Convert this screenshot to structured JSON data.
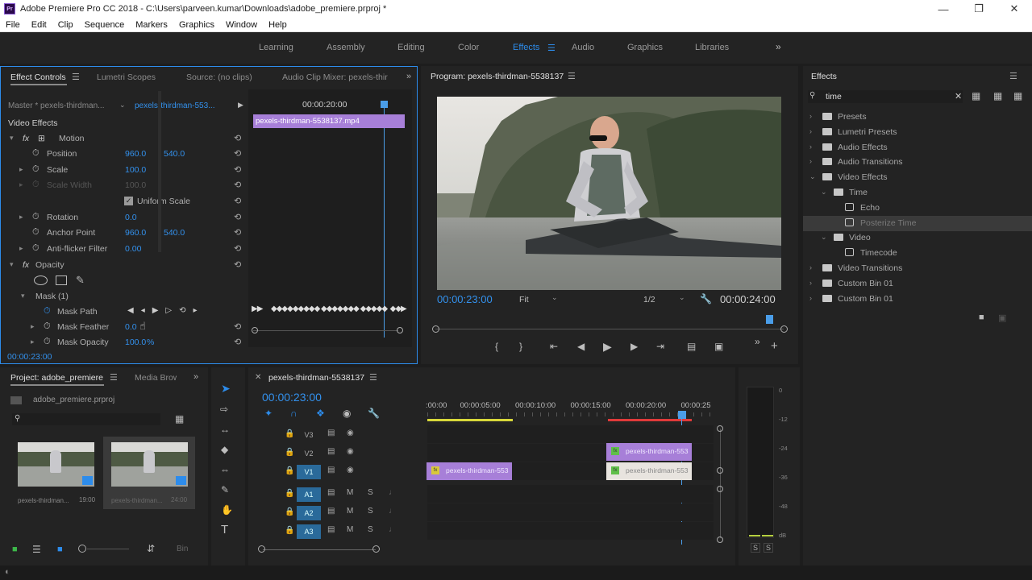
{
  "app": {
    "icon_text": "Pr",
    "title": "Adobe Premiere Pro CC 2018 - C:\\Users\\parveen.kumar\\Downloads\\adobe_premiere.prproj *"
  },
  "menus": [
    "File",
    "Edit",
    "Clip",
    "Sequence",
    "Markers",
    "Graphics",
    "Window",
    "Help"
  ],
  "workspaces": [
    "Learning",
    "Assembly",
    "Editing",
    "Color",
    "Effects",
    "Audio",
    "Graphics",
    "Libraries"
  ],
  "active_workspace": "Effects",
  "effect_controls": {
    "tabs": [
      "Effect Controls",
      "Lumetri Scopes",
      "Source: (no clips)",
      "Audio Clip Mixer: pexels-thir"
    ],
    "master_label": "Master * pexels-thirdman...",
    "sequence_label": "pexels-thirdman-553...",
    "timecode_ruler": "00:00:20:00",
    "clip_name": "pexels-thirdman-5538137.mp4",
    "section": "Video Effects",
    "rows": {
      "motion": "Motion",
      "position": {
        "label": "Position",
        "v1": "960.0",
        "v2": "540.0"
      },
      "scale": {
        "label": "Scale",
        "v1": "100.0"
      },
      "scale_width": {
        "label": "Scale Width",
        "v1": "100.0"
      },
      "uniform_scale": "Uniform Scale",
      "rotation": {
        "label": "Rotation",
        "v1": "0.0"
      },
      "anchor": {
        "label": "Anchor Point",
        "v1": "960.0",
        "v2": "540.0"
      },
      "anti_flicker": {
        "label": "Anti-flicker Filter",
        "v1": "0.00"
      },
      "opacity": "Opacity",
      "mask": "Mask (1)",
      "mask_path": "Mask Path",
      "mask_feather": {
        "label": "Mask Feather",
        "v1": "0.0"
      },
      "mask_opacity": {
        "label": "Mask Opacity",
        "v1": "100.0",
        "unit": "%"
      }
    },
    "current_time": "00:00:23:00"
  },
  "program": {
    "title": "Program: pexels-thirdman-5538137",
    "current_time": "00:00:23:00",
    "fit": "Fit",
    "resolution": "1/2",
    "duration": "00:00:24:00"
  },
  "effects_panel": {
    "title": "Effects",
    "search_value": "time",
    "tree": [
      {
        "label": "Presets",
        "indent": 0,
        "kind": "folder",
        "arrow": "closed"
      },
      {
        "label": "Lumetri Presets",
        "indent": 0,
        "kind": "folder",
        "arrow": "closed"
      },
      {
        "label": "Audio Effects",
        "indent": 0,
        "kind": "folder",
        "arrow": "closed"
      },
      {
        "label": "Audio Transitions",
        "indent": 0,
        "kind": "folder",
        "arrow": "closed"
      },
      {
        "label": "Video Effects",
        "indent": 0,
        "kind": "folder",
        "arrow": "open"
      },
      {
        "label": "Time",
        "indent": 1,
        "kind": "folder",
        "arrow": "open"
      },
      {
        "label": "Echo",
        "indent": 2,
        "kind": "effect",
        "arrow": "none"
      },
      {
        "label": "Posterize Time",
        "indent": 2,
        "kind": "effect",
        "arrow": "none",
        "selected": true
      },
      {
        "label": "Video",
        "indent": 1,
        "kind": "folder",
        "arrow": "open"
      },
      {
        "label": "Timecode",
        "indent": 2,
        "kind": "effect",
        "arrow": "none"
      },
      {
        "label": "Video Transitions",
        "indent": 0,
        "kind": "folder",
        "arrow": "closed"
      },
      {
        "label": "Custom Bin 01",
        "indent": 0,
        "kind": "folder",
        "arrow": "closed"
      },
      {
        "label": "Custom Bin 01",
        "indent": 0,
        "kind": "folder",
        "arrow": "closed"
      }
    ]
  },
  "project": {
    "tabs": [
      "Project: adobe_premiere",
      "Media Brow"
    ],
    "file": "adobe_premiere.prproj",
    "items": [
      {
        "name": "pexels-thirdman...",
        "duration": "19:00"
      },
      {
        "name": "pexels-thirdman...",
        "duration": "24:00"
      }
    ],
    "bin_label": "Bin"
  },
  "timeline": {
    "tab": "pexels-thirdman-5538137",
    "timecode": "00:00:23:00",
    "ruler": [
      ":00:00",
      "00:00:05:00",
      "00:00:10:00",
      "00:00:15:00",
      "00:00:20:00",
      "00:00:25"
    ],
    "tracks": [
      {
        "name": "V3",
        "on": false,
        "kind": "video"
      },
      {
        "name": "V2",
        "on": false,
        "kind": "video"
      },
      {
        "name": "V1",
        "on": true,
        "kind": "video"
      },
      {
        "name": "A1",
        "on": true,
        "kind": "audio"
      },
      {
        "name": "A2",
        "on": true,
        "kind": "audio"
      },
      {
        "name": "A3",
        "on": true,
        "kind": "audio"
      }
    ],
    "clips": [
      {
        "label": "pexels-thirdman-553",
        "badge": "fx"
      },
      {
        "label": "pexels-thirdman-553",
        "badge": "fx"
      },
      {
        "label": "pexels-thirdman-553",
        "badge": "fx"
      }
    ],
    "audio_btn_m": "M",
    "audio_btn_s": "S"
  },
  "meters": {
    "scale": [
      "0",
      "-12",
      "-24",
      "-36",
      "-48",
      "dB"
    ],
    "solo": [
      "S",
      "S"
    ]
  },
  "colors": {
    "accent": "#2d8ceb",
    "clip": "#a77fd8",
    "work_area": "#d8d83a",
    "render_red": "#e03a3a"
  }
}
